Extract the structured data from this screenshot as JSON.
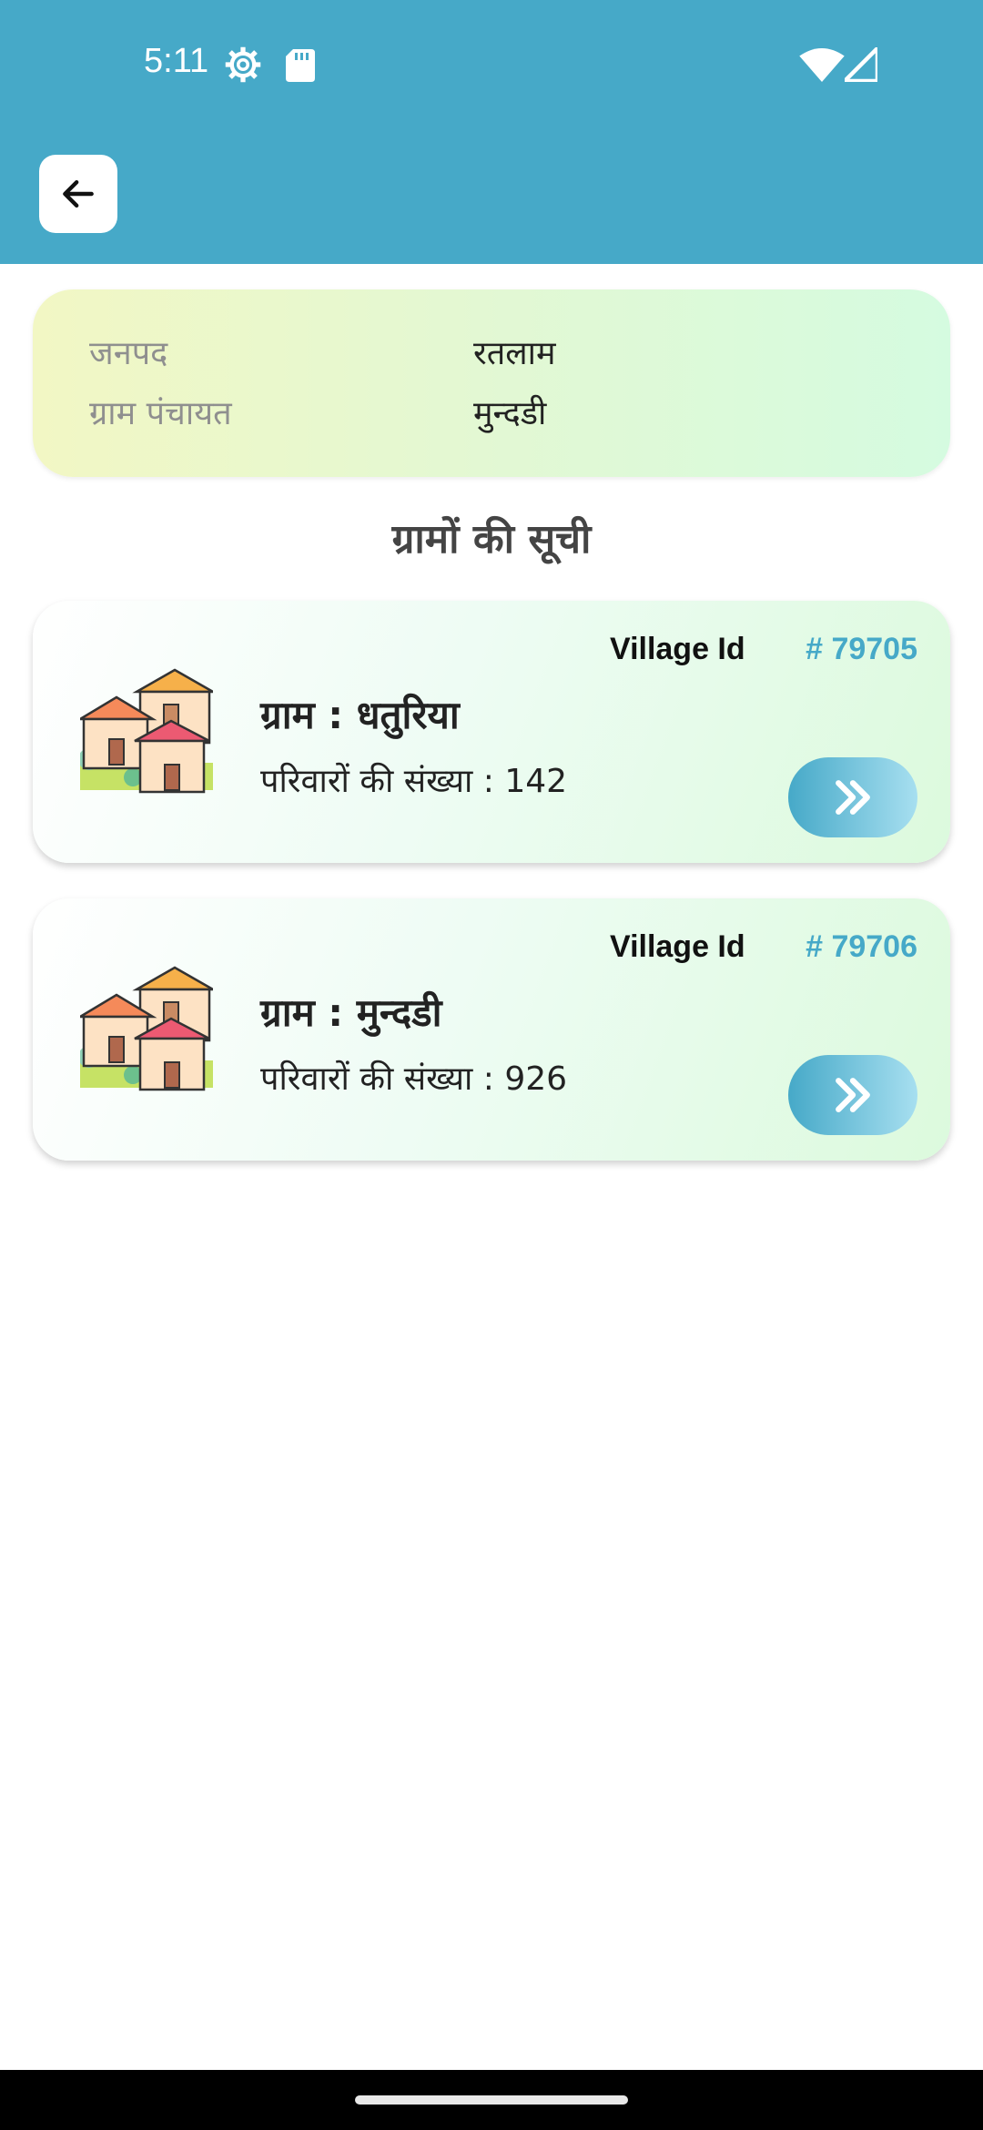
{
  "status_bar": {
    "time": "5:11",
    "icons": [
      "gear-icon",
      "sd-card-icon",
      "wifi-icon",
      "signal-icon"
    ]
  },
  "header": {
    "back_icon": "arrow-left-icon"
  },
  "info": {
    "janpad_label": "जनपद",
    "janpad_value": "रतलाम",
    "panchayat_label": "ग्राम पंचायत",
    "panchayat_value": "मुन्दडी"
  },
  "list_title": "ग्रामों की सूची",
  "villages": [
    {
      "id_label": "Village Id",
      "id_value": "# 79705",
      "name": "ग्राम : धतुरिया",
      "families": "परिवारों की संख्या : 142"
    },
    {
      "id_label": "Village Id",
      "id_value": "# 79706",
      "name": "ग्राम : मुन्दडी",
      "families": "परिवारों की संख्या : 926"
    }
  ],
  "colors": {
    "primary": "#46a9c8",
    "info_gradient_start": "#f2f7c4",
    "info_gradient_end": "#d5fbe0"
  }
}
